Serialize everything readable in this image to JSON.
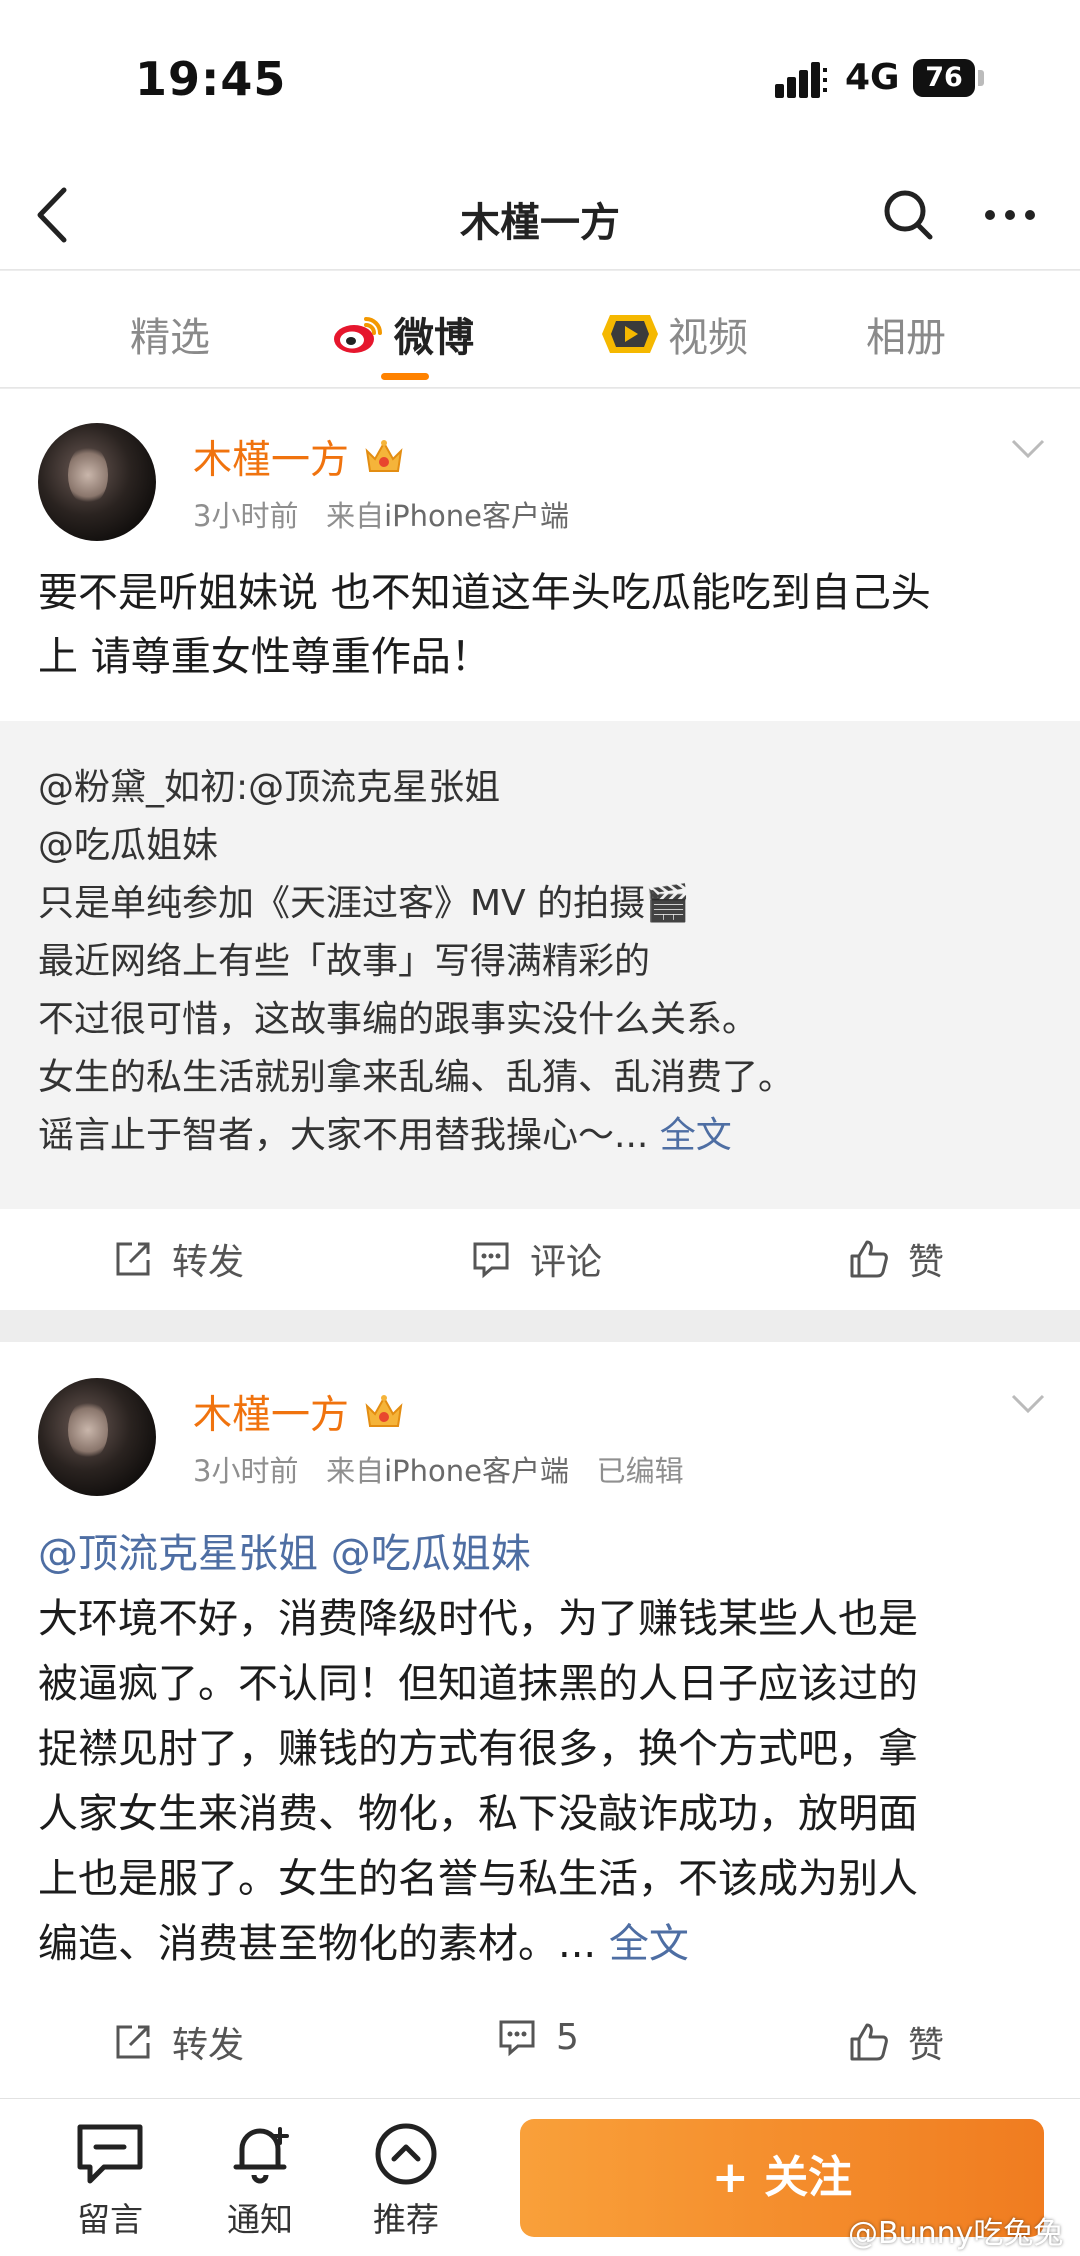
{
  "status": {
    "time": "19:45",
    "network": "4G",
    "battery": "76"
  },
  "nav": {
    "title": "木槿一方"
  },
  "tabs": [
    {
      "label": "精选"
    },
    {
      "label": "微博"
    },
    {
      "label": "视频"
    },
    {
      "label": "相册"
    }
  ],
  "posts": [
    {
      "username": "木槿一方",
      "time": "3小时前",
      "source_prefix": "来自",
      "source": "iPhone客户端",
      "edited": "",
      "text_lines": [
        "要不是听姐妹说 也不知道这年头吃瓜能吃到自己头",
        "上 请尊重女性尊重作品！"
      ],
      "repost": {
        "mentions_line1": "@粉黛_如初:@顶流克星张姐",
        "mentions_line2": "@吃瓜姐妹",
        "lines": [
          "只是单纯参加《天涯过客》MV 的拍摄🎬",
          "最近网络上有些「故事」写得满精彩的",
          "不过很可惜，这故事编的跟事实没什么关系。",
          "女生的私生活就别拿来乱编、乱猜、乱消费了。",
          "谣言止于智者，大家不用替我操心～..."
        ],
        "full_link": "全文"
      },
      "actions": {
        "repost": "转发",
        "comment": "评论",
        "like": "赞"
      }
    },
    {
      "username": "木槿一方",
      "time": "3小时前",
      "source_prefix": "来自",
      "source": "iPhone客户端",
      "edited": "已编辑",
      "mentions": "@顶流克星张姐 @吃瓜姐妹",
      "text_lines": [
        "大环境不好，消费降级时代，为了赚钱某些人也是",
        "被逼疯了。不认同！但知道抹黑的人日子应该过的",
        "捉襟见肘了，赚钱的方式有很多，换个方式吧，拿",
        "人家女生来消费、物化，私下没敲诈成功，放明面",
        "上也是服了。女生的名誉与私生活，不该成为别人",
        "编造、消费甚至物化的素材。..."
      ],
      "full_link": "全文",
      "actions": {
        "repost": "转发",
        "comment": "5",
        "like": "赞"
      }
    }
  ],
  "bottom": {
    "message": "留言",
    "notify": "通知",
    "recommend": "推荐",
    "follow": "+ 关注"
  },
  "watermark": "@Bunny吃兔兔",
  "colors": {
    "accent": "#f0730e",
    "link": "#4e6ea3",
    "follow": "#f08a2c"
  }
}
